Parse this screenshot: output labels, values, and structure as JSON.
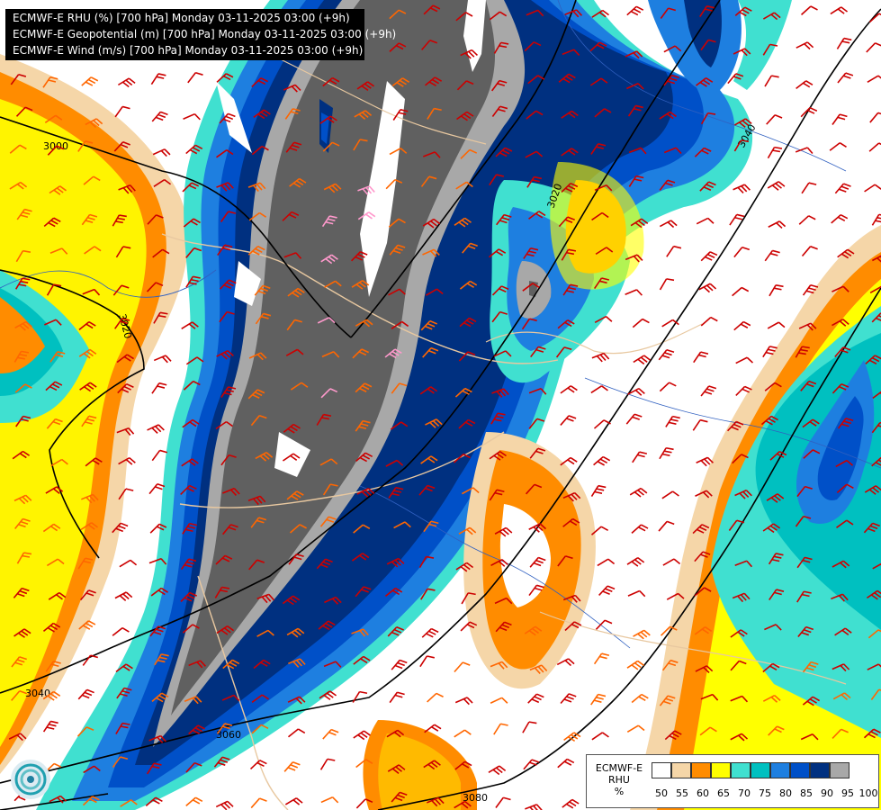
{
  "title_lines": [
    "ECMWF-E RHU (%) [700 hPa] Monday 03-11-2025 03:00 (+9h)",
    "ECMWF-E Geopotential (m) [700 hPa] Monday 03-11-2025 03:00 (+9h)",
    "ECMWF-E Wind (m/s) [700 hPa] Monday 03-11-2025 03:00 (+9h)"
  ],
  "legend": {
    "title_lines": [
      "ECMWF-E",
      "RHU",
      "%"
    ],
    "ticks": [
      "50",
      "55",
      "60",
      "65",
      "70",
      "75",
      "80",
      "85",
      "90",
      "95",
      "100"
    ],
    "colors": [
      "#ffffff",
      "#f5d6a8",
      "#ff8c00",
      "#ffff00",
      "#40e0d0",
      "#00c0c0",
      "#1e7fe0",
      "#0050c8",
      "#003080",
      "#a8a8a8",
      "#606060"
    ]
  },
  "contour_labels": [
    "3000",
    "3020",
    "3040",
    "3060",
    "3080"
  ],
  "contour_color": "#000000",
  "wind_barb_colors": [
    "#cc0000",
    "#ff6600",
    "#ff99cc"
  ],
  "border_color": "#e8c8a0",
  "river_color": "#3060c0",
  "logo": "ecmwf-logo-icon"
}
